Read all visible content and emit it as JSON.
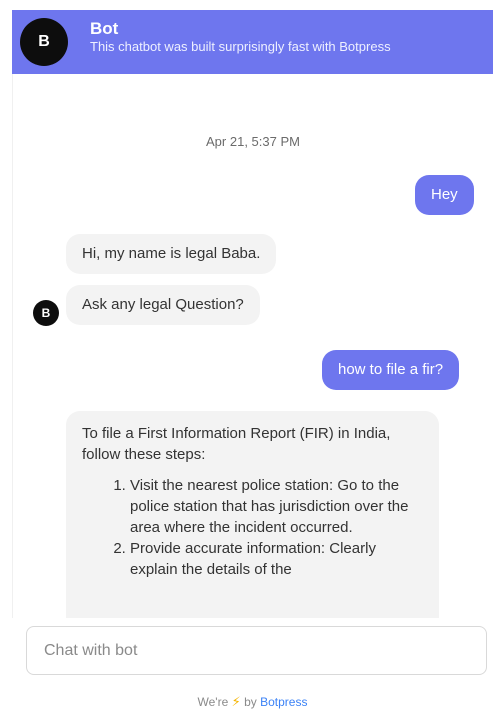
{
  "header": {
    "avatar_letter": "B",
    "title": "Bot",
    "subtitle": "This chatbot was built surprisingly fast with Botpress"
  },
  "messages": {
    "timestamp": "Apr 21, 5:37 PM",
    "user_1": "Hey",
    "bot_1": "Hi, my name is legal Baba.",
    "bot_2": "Ask any legal Question?",
    "bot_avatar_letter": "B",
    "user_2": "how to file a fir?",
    "bot_3": {
      "intro": "To file a First Information Report (FIR) in India, follow these steps:",
      "steps": [
        "Visit the nearest police station: Go to the police station that has jurisdiction over the area where the incident occurred.",
        "Provide accurate information: Clearly explain the details of the"
      ]
    }
  },
  "composer": {
    "placeholder": "Chat with bot"
  },
  "footer": {
    "prefix": "We're",
    "bolt_icon": "lightning-bolt-icon",
    "by": "by",
    "brand": "Botpress"
  }
}
